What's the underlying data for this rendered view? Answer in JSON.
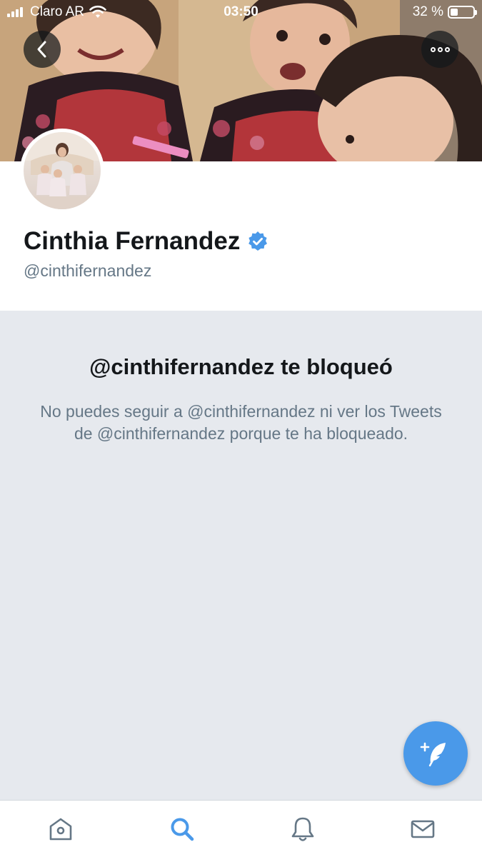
{
  "status_bar": {
    "carrier": "Claro AR",
    "time": "03:50",
    "battery_label": "32 %",
    "battery_level": 0.32
  },
  "header": {
    "back_icon": "chevron-left-icon",
    "more_icon": "more-dots-icon"
  },
  "profile": {
    "display_name": "Cinthia Fernandez",
    "handle": "@cinthifernandez",
    "verified": true,
    "verified_color": "#4a99e9"
  },
  "blocked": {
    "title": "@cinthifernandez te bloqueó",
    "message": "No puedes seguir a @cinthifernandez ni ver los Tweets de @cinthifernandez porque te ha bloqueado."
  },
  "compose": {
    "icon": "compose-tweet-icon",
    "color": "#4a99e9"
  },
  "tabs": [
    {
      "name": "home",
      "icon": "home-icon",
      "active": false
    },
    {
      "name": "search",
      "icon": "search-icon",
      "active": true
    },
    {
      "name": "notifications",
      "icon": "bell-icon",
      "active": false
    },
    {
      "name": "messages",
      "icon": "mail-icon",
      "active": false
    }
  ],
  "colors": {
    "accent": "#4a99e9",
    "background": "#e6e9ee",
    "secondary_text": "#657786",
    "icon_inactive": "#657786"
  }
}
